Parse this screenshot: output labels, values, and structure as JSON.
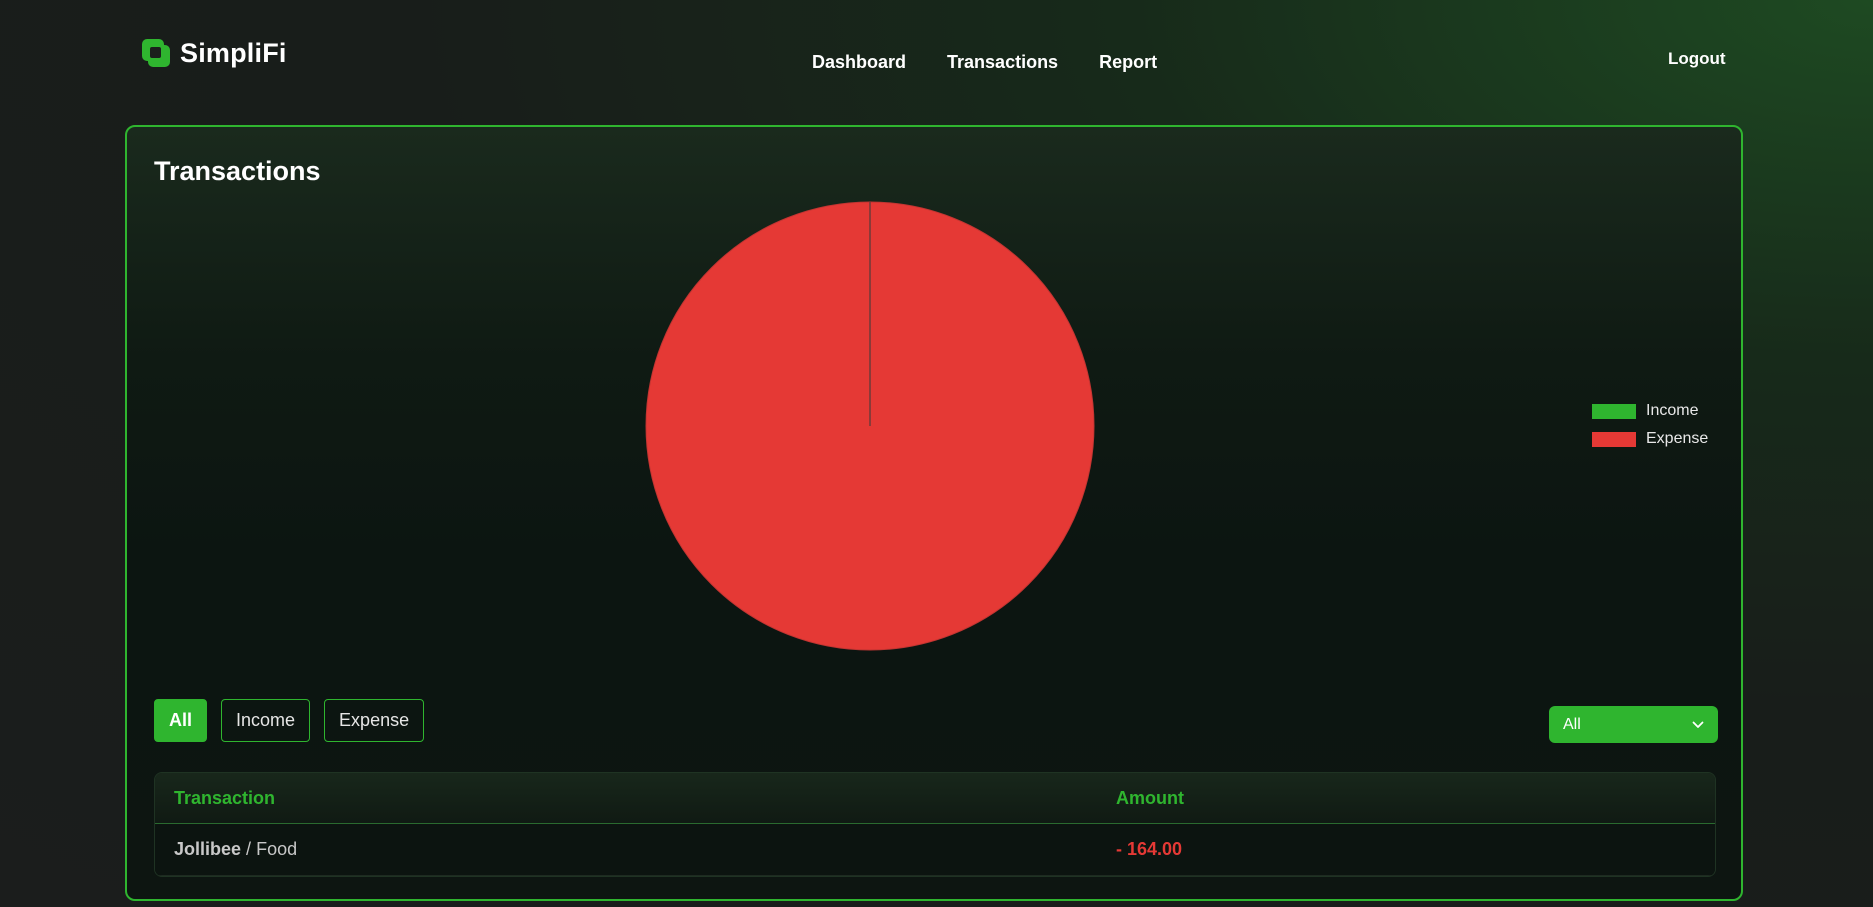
{
  "app": {
    "name": "SimpliFi"
  },
  "nav": {
    "dashboard": "Dashboard",
    "transactions": "Transactions",
    "report": "Report",
    "logout": "Logout"
  },
  "page": {
    "title": "Transactions"
  },
  "colors": {
    "accent": "#2fb52f",
    "income": "#2fb52f",
    "expense": "#e53935"
  },
  "legend": {
    "income": "Income",
    "expense": "Expense"
  },
  "chart_data": {
    "type": "pie",
    "categories": [
      "Income",
      "Expense"
    ],
    "values": [
      0,
      164.0
    ],
    "colors": [
      "#2fb52f",
      "#e53935"
    ],
    "legend_position": "right"
  },
  "filters": {
    "all": "All",
    "income": "Income",
    "expense": "Expense",
    "selected": "All"
  },
  "select": {
    "value": "All"
  },
  "table": {
    "headers": {
      "transaction": "Transaction",
      "amount": "Amount"
    },
    "rows": [
      {
        "merchant": "Jollibee",
        "separator": "/",
        "category": "Food",
        "amount": "- 164.00"
      }
    ]
  }
}
